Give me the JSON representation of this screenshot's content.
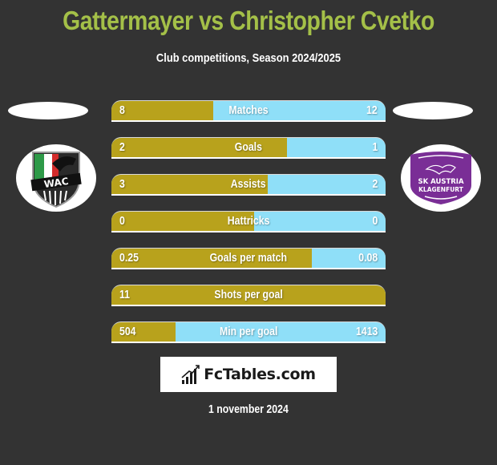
{
  "header": {
    "title": "Gattermayer vs Christopher Cvetko",
    "subtitle": "Club competitions, Season 2024/2025"
  },
  "teams": {
    "left": {
      "logo_icon": "wac-club-crest-icon",
      "logo_text": "WAC"
    },
    "right": {
      "logo_icon": "sk-austria-klagenfurt-crest-icon",
      "logo_text_line1": "SK AUSTRIA",
      "logo_text_line2": "KLAGENFURT"
    }
  },
  "colors": {
    "title": "#a4c048",
    "left_bar": "#b8a21c",
    "right_bar": "#8fdff8",
    "background": "#333333"
  },
  "stats": [
    {
      "label": "Matches",
      "left": "8",
      "right": "12",
      "left_share": 0.37
    },
    {
      "label": "Goals",
      "left": "2",
      "right": "1",
      "left_share": 0.64
    },
    {
      "label": "Assists",
      "left": "3",
      "right": "2",
      "left_share": 0.57
    },
    {
      "label": "Hattricks",
      "left": "0",
      "right": "0",
      "left_share": 0.52
    },
    {
      "label": "Goals per match",
      "left": "0.25",
      "right": "0.08",
      "left_share": 0.73
    },
    {
      "label": "Shots per goal",
      "left": "11",
      "right": "",
      "left_share": 1.0
    },
    {
      "label": "Min per goal",
      "left": "504",
      "right": "1413",
      "left_share": 0.234
    }
  ],
  "footer": {
    "brand": "FcTables.com",
    "brand_icon": "bar-chart-trend-icon",
    "date": "1 november 2024"
  }
}
